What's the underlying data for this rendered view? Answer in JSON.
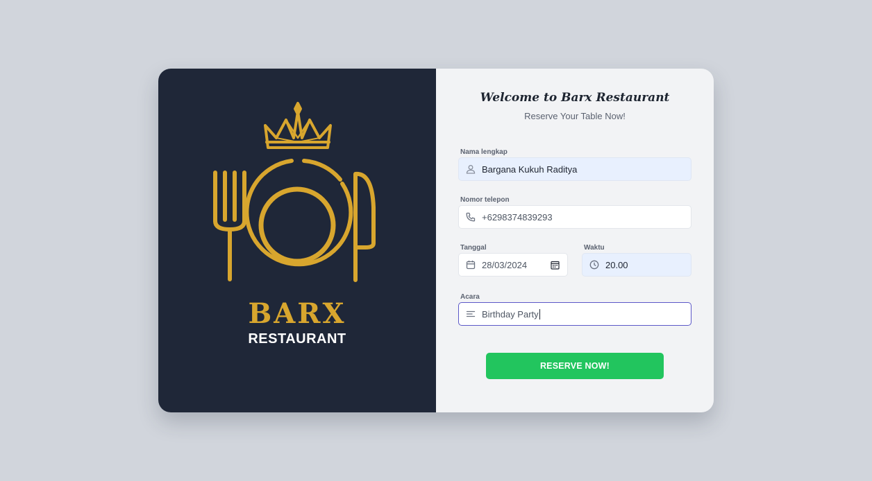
{
  "brand": {
    "name": "BARX",
    "tagline": "RESTAURANT",
    "logo_icon": "crown-plate-cutlery-logo",
    "gold": "#d8a62e",
    "panel_bg": "#1f2738"
  },
  "form": {
    "title": "Welcome to Barx Restaurant",
    "subtitle": "Reserve Your Table Now!",
    "name": {
      "label": "Nama lengkap",
      "value": "Bargana Kukuh Raditya",
      "icon": "user-icon"
    },
    "phone": {
      "label": "Nomor telepon",
      "value": "+6298374839293",
      "icon": "phone-icon"
    },
    "date": {
      "label": "Tanggal",
      "value": "28/03/2024",
      "icon": "calendar-icon",
      "picker_icon": "calendar-picker-icon"
    },
    "time": {
      "label": "Waktu",
      "value": "20.00",
      "icon": "clock-icon"
    },
    "event": {
      "label": "Acara",
      "value": "Birthday Party",
      "icon": "text-lines-icon"
    },
    "submit_label": "RESERVE NOW!",
    "accent": "#22c55e",
    "focus_color": "#5b57c7"
  }
}
